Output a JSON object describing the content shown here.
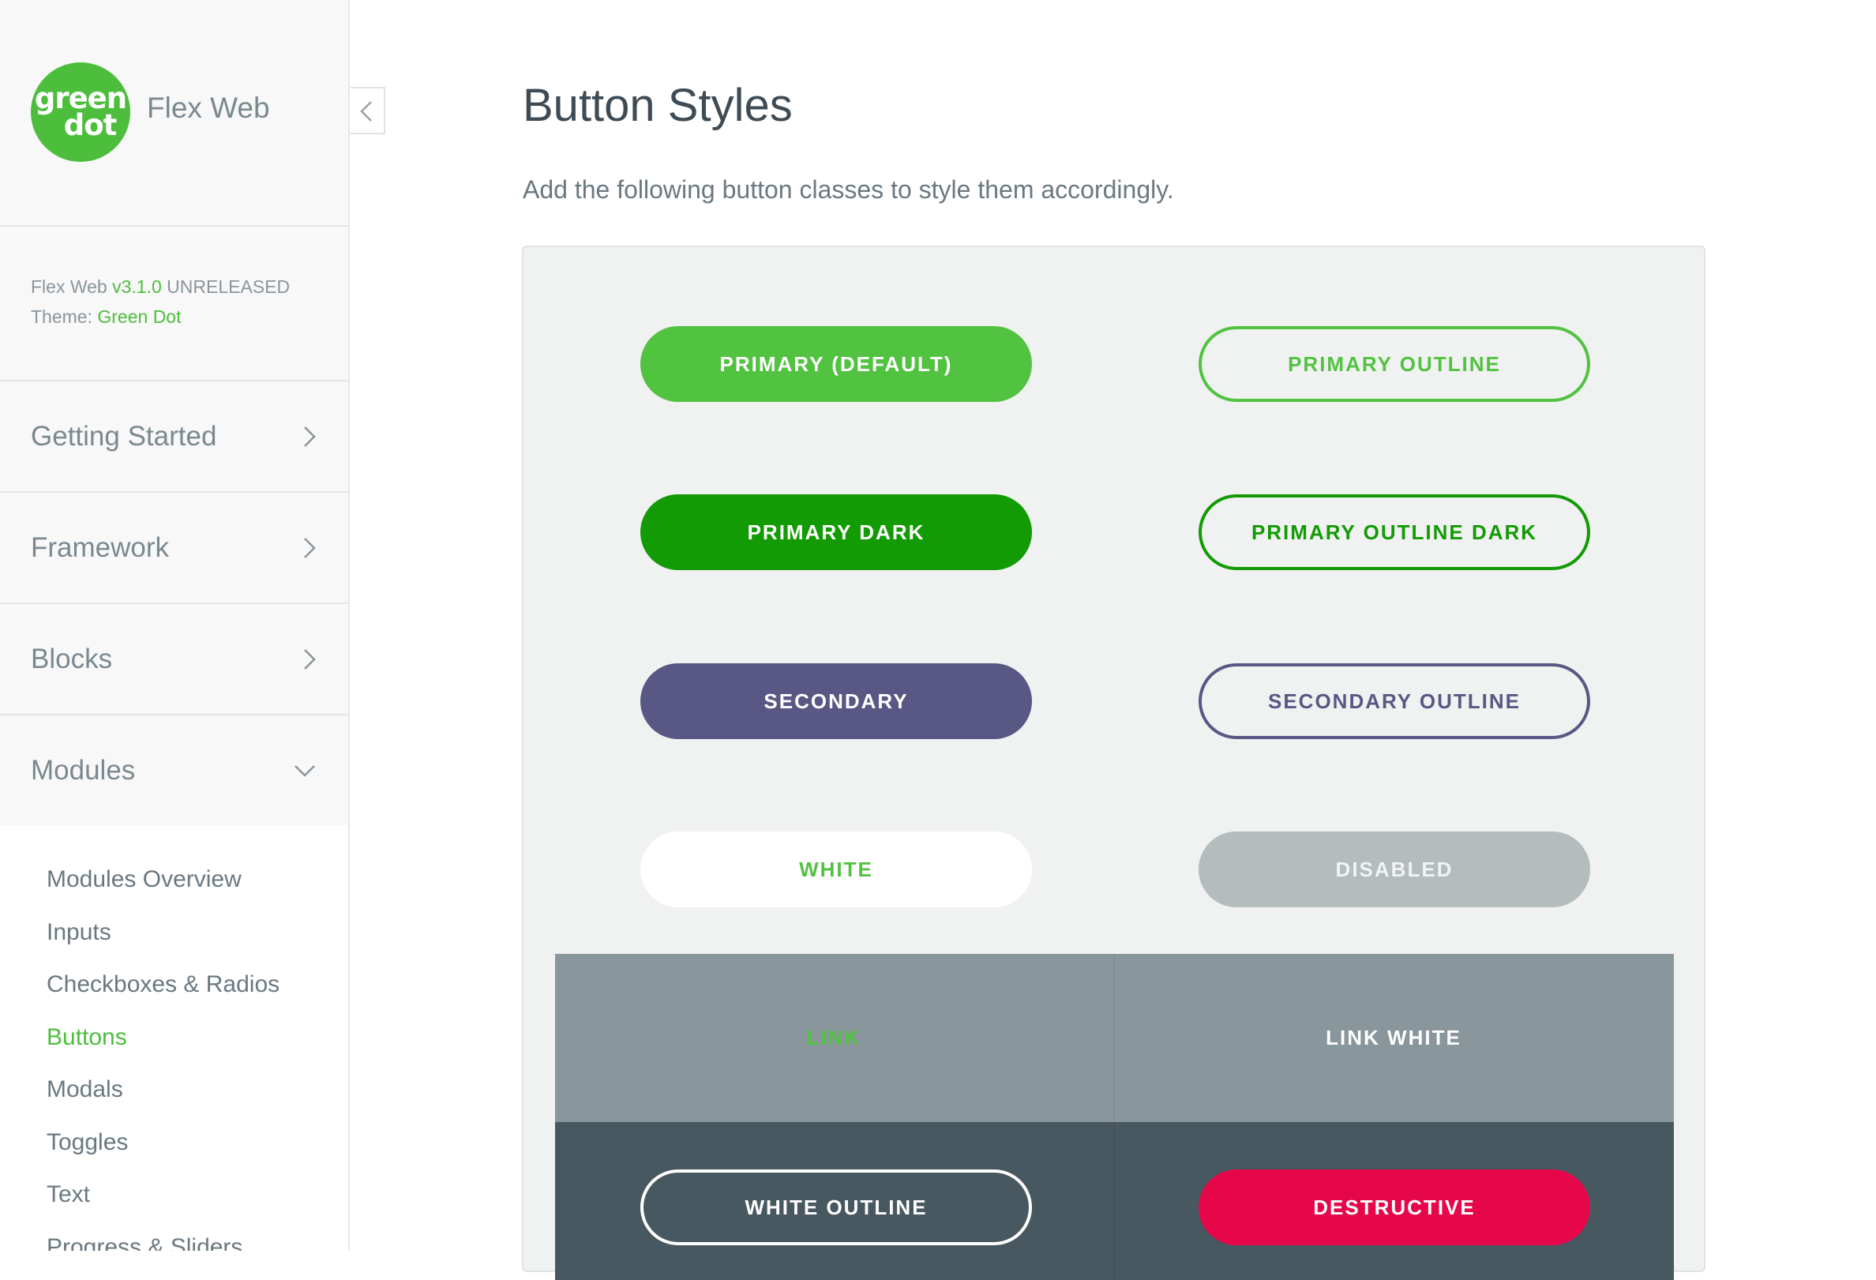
{
  "sidebar": {
    "logo_line1": "green",
    "logo_line2": "dot",
    "app_name": "Flex Web",
    "version_prefix": "Flex Web",
    "version_number": "v3.1.0",
    "version_status": "UNRELEASED",
    "theme_label": "Theme:",
    "theme_name": "Green Dot",
    "nav_items": [
      {
        "label": "Getting Started"
      },
      {
        "label": "Framework"
      },
      {
        "label": "Blocks"
      },
      {
        "label": "Modules"
      }
    ],
    "sub_items": [
      {
        "label": "Modules Overview"
      },
      {
        "label": "Inputs"
      },
      {
        "label": "Checkboxes & Radios"
      },
      {
        "label": "Buttons"
      },
      {
        "label": "Modals"
      },
      {
        "label": "Toggles"
      },
      {
        "label": "Text"
      },
      {
        "label": "Progress & Sliders"
      }
    ],
    "active_sub_item": "Buttons"
  },
  "main": {
    "title": "Button Styles",
    "description": "Add the following button classes to style them accordingly.",
    "buttons": {
      "primary": "PRIMARY (DEFAULT)",
      "primary_outline": "PRIMARY OUTLINE",
      "primary_dark": "PRIMARY DARK",
      "primary_outline_dark": "PRIMARY OUTLINE DARK",
      "secondary": "SECONDARY",
      "secondary_outline": "SECONDARY OUTLINE",
      "white": "WHITE",
      "disabled": "DISABLED",
      "link": "LINK",
      "link_white": "LINK WHITE",
      "white_outline": "WHITE OUTLINE",
      "destructive": "DESTRUCTIVE"
    }
  },
  "colors": {
    "brand_green": "#52c241",
    "primary_dark": "#129b04",
    "secondary": "#595784",
    "destructive": "#e5074a",
    "disabled": "#b4bcbd"
  },
  "icons": {
    "collapse": "chevron-left-icon",
    "nav_collapsed": "chevron-right-icon",
    "nav_expanded": "chevron-down-icon"
  }
}
